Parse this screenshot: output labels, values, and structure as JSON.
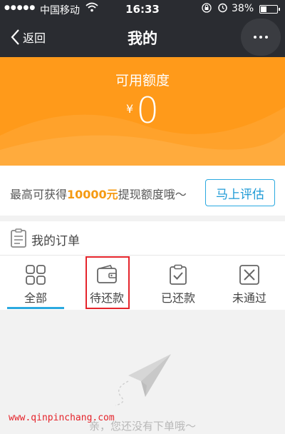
{
  "status_bar": {
    "signal": "●●●●●",
    "carrier": "中国移动",
    "time": "16:33",
    "battery_percent": "38%",
    "battery_level": 0.38
  },
  "nav": {
    "back_label": "返回",
    "title": "我的"
  },
  "credit": {
    "label": "可用额度",
    "currency": "¥",
    "amount": "0"
  },
  "promo": {
    "text_prefix": "最高可获得",
    "text_amount": "10000元",
    "text_suffix": "提现额度哦～",
    "button_label": "马上评估",
    "accent_color": "#f59a12",
    "button_color": "#2aa9e0"
  },
  "orders": {
    "title": "我的订单",
    "tabs": [
      {
        "label": "全部",
        "icon": "grid-icon"
      },
      {
        "label": "待还款",
        "icon": "wallet-icon"
      },
      {
        "label": "已还款",
        "icon": "clipboard-check-icon"
      },
      {
        "label": "未通过",
        "icon": "x-box-icon"
      }
    ],
    "selected_tab": 0
  },
  "empty": {
    "message": "亲，您还没有下单哦～",
    "icon": "paper-plane-icon"
  },
  "watermark": "www.qinpinchang.com",
  "colors": {
    "header_dark": "#2a2c31",
    "orange": "#ff9a1a",
    "highlight_red": "#e5242b"
  }
}
